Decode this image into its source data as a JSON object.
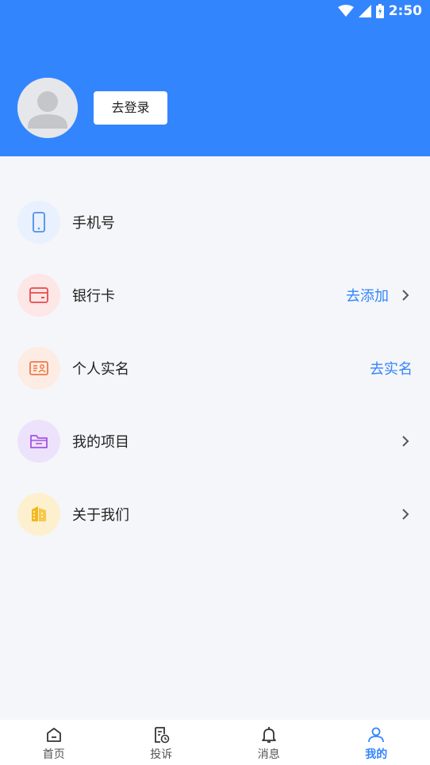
{
  "status_bar": {
    "time": "2:50",
    "icons": [
      "wifi-icon",
      "signal-icon",
      "battery-icon"
    ]
  },
  "header": {
    "login_label": "去登录",
    "avatar_icon": "user-avatar-icon",
    "background": "#3385fd"
  },
  "menu": {
    "items": [
      {
        "label": "手机号",
        "icon": "phone-icon",
        "action": "",
        "chevron": false
      },
      {
        "label": "银行卡",
        "icon": "bank-card-icon",
        "action": "去添加",
        "chevron": true
      },
      {
        "label": "个人实名",
        "icon": "id-card-icon",
        "action": "去实名",
        "chevron": false
      },
      {
        "label": "我的项目",
        "icon": "folder-icon",
        "action": "",
        "chevron": true
      },
      {
        "label": "关于我们",
        "icon": "building-icon",
        "action": "",
        "chevron": true
      }
    ]
  },
  "tabbar": {
    "tabs": [
      {
        "label": "首页",
        "icon": "home-icon",
        "active": false
      },
      {
        "label": "投诉",
        "icon": "complaint-icon",
        "active": false
      },
      {
        "label": "消息",
        "icon": "bell-icon",
        "active": false
      },
      {
        "label": "我的",
        "icon": "profile-icon",
        "active": true
      }
    ]
  },
  "colors": {
    "accent": "#3385fd",
    "page_bg": "#f5f6f9"
  }
}
